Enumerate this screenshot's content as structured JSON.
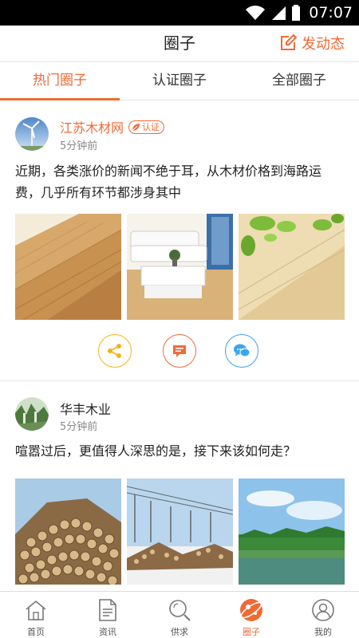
{
  "status_bar": {
    "time": "07:07"
  },
  "header": {
    "title": "圈子",
    "post_label": "发动态"
  },
  "tabs": [
    {
      "label": "热门圈子",
      "active": true
    },
    {
      "label": "认证圈子",
      "active": false
    },
    {
      "label": "全部圈子",
      "active": false
    }
  ],
  "posts": [
    {
      "author": "江苏木材网",
      "verified_label": "认证",
      "time": "5分钟前",
      "text": "近期，各类涨价的新闻不绝于耳，从木材价格到海路运费，几乎所有环节都涉身其中",
      "images": [
        "wood-floor-planks",
        "living-room",
        "green-leaves-wood"
      ]
    },
    {
      "author": "华丰木业",
      "time": "5分钟前",
      "text": "喧嚣过后，更值得人深思的是，接下来该如何走？",
      "images": [
        "log-pile",
        "log-yard-snow",
        "lake-landscape"
      ]
    }
  ],
  "bottom_nav": [
    {
      "label": "首页",
      "icon": "home-icon",
      "active": false
    },
    {
      "label": "资讯",
      "icon": "document-icon",
      "active": false
    },
    {
      "label": "供求",
      "icon": "search-icon",
      "active": false
    },
    {
      "label": "圈子",
      "icon": "planet-icon",
      "active": true
    },
    {
      "label": "我的",
      "icon": "user-icon",
      "active": false
    }
  ],
  "colors": {
    "accent": "#f06a35",
    "share": "#f5b316",
    "comment": "#f06a35",
    "chat": "#3aa6f0"
  }
}
